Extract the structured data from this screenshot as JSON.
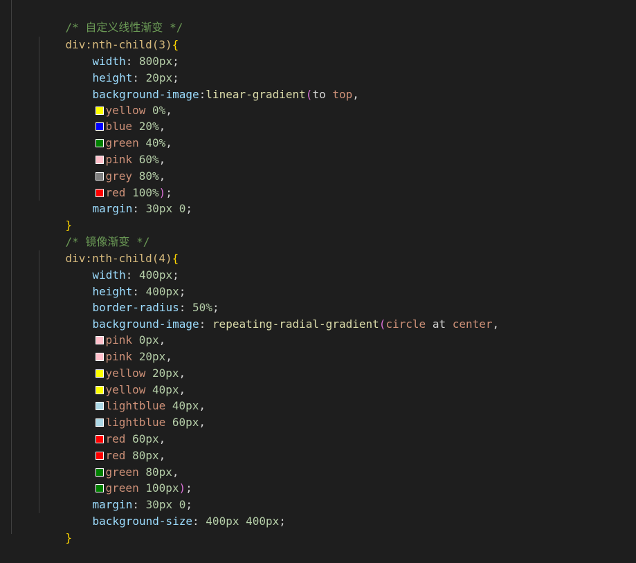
{
  "lines": {
    "comment_linear": "/* 自定义线性渐变 */",
    "sel_child3": "div:nth-child(3)",
    "brace_open": "{",
    "brace_close": "}",
    "prop_width": "width",
    "prop_height": "height",
    "prop_bg_image": "background-image",
    "prop_margin": "margin",
    "prop_border_radius": "border-radius",
    "prop_bg_size": "background-size",
    "colon": ":",
    "colon_space": ": ",
    "semi": ";",
    "comma": ",",
    "paren_open": "(",
    "paren_close": ")",
    "v_800px": "800px",
    "v_20px": "20px",
    "v_30px": "30px",
    "v_0": "0",
    "fn_linear": "linear-gradient",
    "to": "to",
    "top": "top",
    "comment_mirror": "/* 镜像渐变 */",
    "sel_child4": "div:nth-child(4)",
    "v_400px": "400px",
    "v_50pct": "50%",
    "fn_radial": "repeating-radial-gradient",
    "circle": "circle",
    "at": "at",
    "center": "center",
    "v_400x400": "400px 400px"
  },
  "linear_stops": [
    {
      "name": "yellow",
      "pos": "0%",
      "color": "#ffff00"
    },
    {
      "name": "blue",
      "pos": "20%",
      "color": "#0000ff"
    },
    {
      "name": "green",
      "pos": "40%",
      "color": "#008000"
    },
    {
      "name": "pink",
      "pos": "60%",
      "color": "#ffc0cb"
    },
    {
      "name": "grey",
      "pos": "80%",
      "color": "#808080"
    },
    {
      "name": "red",
      "pos": "100%",
      "color": "#ff0000"
    }
  ],
  "radial_stops": [
    {
      "name": "pink",
      "pos": "0px",
      "color": "#ffc0cb"
    },
    {
      "name": "pink",
      "pos": "20px",
      "color": "#ffc0cb"
    },
    {
      "name": "yellow",
      "pos": "20px",
      "color": "#ffff00"
    },
    {
      "name": "yellow",
      "pos": "40px",
      "color": "#ffff00"
    },
    {
      "name": "lightblue",
      "pos": "40px",
      "color": "#add8e6"
    },
    {
      "name": "lightblue",
      "pos": "60px",
      "color": "#add8e6"
    },
    {
      "name": "red",
      "pos": "60px",
      "color": "#ff0000"
    },
    {
      "name": "red",
      "pos": "80px",
      "color": "#ff0000"
    },
    {
      "name": "green",
      "pos": "80px",
      "color": "#008000"
    },
    {
      "name": "green",
      "pos": "100px",
      "color": "#008000"
    }
  ],
  "theme": {
    "background": "#1e1e1e",
    "comment": "#6a9955",
    "selector": "#d7ba7d",
    "brace": "#ffd700",
    "paren": "#da70d6",
    "property": "#9cdcfe",
    "number": "#b5cea8",
    "value": "#ce9178",
    "function": "#dcdcaa"
  }
}
